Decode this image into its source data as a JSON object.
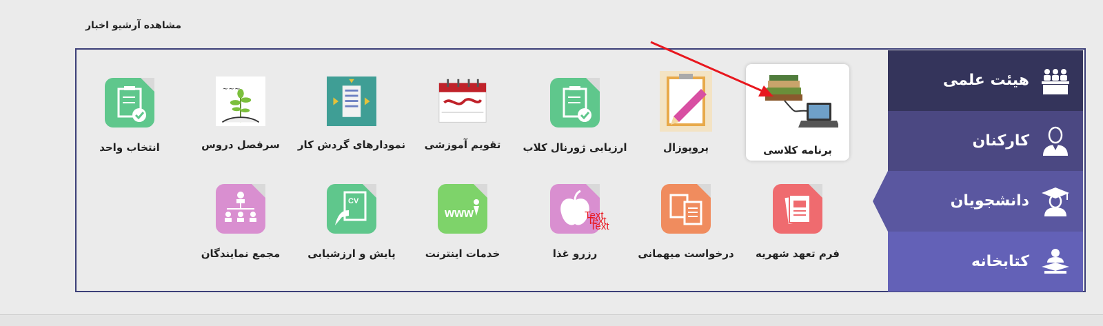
{
  "header": {
    "archive_link": "مشاهده آرشیو اخبار"
  },
  "sidebar": {
    "items": [
      {
        "label": "هیئت علمی",
        "icon": "faculty-icon"
      },
      {
        "label": "کارکنان",
        "icon": "staff-icon"
      },
      {
        "label": "دانشجویان",
        "icon": "graduate-cap-icon",
        "active": true
      },
      {
        "label": "کتابخانه",
        "icon": "reader-icon"
      }
    ]
  },
  "tiles_row1": [
    {
      "label": "برنامه کلاسی",
      "icon": "books-laptop-icon",
      "selected": true
    },
    {
      "label": "پروپوزال",
      "icon": "clipboard-pencil-icon"
    },
    {
      "label": "ارزیابی ژورنال کلاب",
      "icon": "checklist-icon"
    },
    {
      "label": "تقویم آموزشی",
      "icon": "calendar-icon"
    },
    {
      "label": "نمودارهای گردش کار",
      "icon": "workflow-icon"
    },
    {
      "label": "سرفصل دروس",
      "icon": "plant-icon"
    },
    {
      "label": "انتخاب واحد",
      "icon": "checklist-icon"
    }
  ],
  "tiles_row2": [
    {
      "label": "فرم تعهد شهریه",
      "icon": "documents-icon"
    },
    {
      "label": "درخواست میهمانی",
      "icon": "document-exchange-icon"
    },
    {
      "label": "رزرو غذا",
      "icon": "apple-icon",
      "overlay": "Text"
    },
    {
      "label": "خدمات اینترنت",
      "icon": "www-icon"
    },
    {
      "label": "پایش و ارزشیابی",
      "icon": "cv-icon"
    },
    {
      "label": "مجمع نمایندگان",
      "icon": "org-chart-icon"
    }
  ],
  "colors": {
    "border": "#3c3f78",
    "side1": "#34345b",
    "side2": "#4b4882",
    "side3": "#5a57a0",
    "side4": "#6361b7",
    "arrow": "#e8171e"
  }
}
